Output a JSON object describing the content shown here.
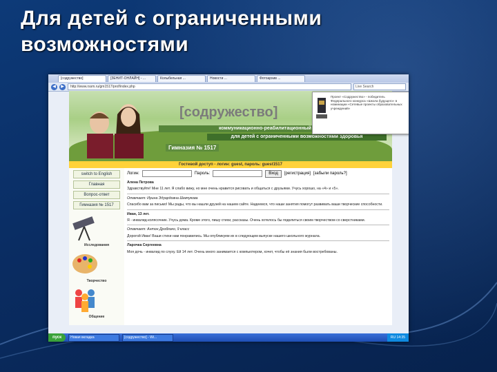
{
  "slide": {
    "title_line1": "Для детей с ограниченными",
    "title_line2": "возможностями"
  },
  "browser": {
    "tabs": [
      {
        "label": "[содружество]",
        "active": true
      },
      {
        "label": "[ЗЕНИТ-ОНЛАЙН] - ...",
        "active": false
      },
      {
        "label": "Колыбельная ...",
        "active": false
      },
      {
        "label": "Новости ...",
        "active": false
      },
      {
        "label": "Фотоархив ...",
        "active": false
      }
    ],
    "address": "http://www.rssm.ru/gm1517/prof/index.php",
    "search_placeholder": "Live Search"
  },
  "site": {
    "brand": "[содружество]",
    "tagline1": "коммуникационно-реабилитационный центр",
    "tagline2": "для детей с ограниченными возможностями здоровья",
    "school": "Гимназия № 1517",
    "guest_notice": "Гостевой доступ - логин: guest, пароль: guest1517",
    "login": {
      "login_label": "Логин:",
      "password_label": "Пароль:",
      "enter_button": "Вход",
      "register_link": "[регистрация]",
      "forgot_link": "[забыли пароль?]"
    },
    "sidebar": {
      "links": [
        "switch to English",
        "Главная",
        "Вопрос-ответ",
        "Гимназия № 1517"
      ],
      "sections": [
        "Исследования",
        "Творчество",
        "Общение"
      ]
    },
    "posts": [
      {
        "author": "Алена Петрова",
        "text": "Здравствуйте! Мне 11 лет. Я слабо вижу, но мне очень нравится рисовать и общаться с друзьями. Учусь хорошо, на «4» и «5»."
      },
      {
        "author": "Отвечает: Ирина Эдуардовна Шевчукова",
        "text": "Спасибо вам за письмо! Мы рады, что вы нашли друзей на нашем сайте. Надеемся, что наши занятия помогут развивать ваши творческие способности."
      },
      {
        "author": "Иван, 13 лет.",
        "text": "Я - инвалид-колясочник. Учусь дома. Кроме этого, пишу стихи, рассказы. Очень хотелось бы поделиться своим творчеством со сверстниками."
      },
      {
        "author": "Отвечает: Антон Дробязко, 9 класс",
        "text": "Дорогой Иван! Ваши стихи нам понравились. Мы опубликуем их в следующем выпуске нашего школьного журнала."
      },
      {
        "author": "Ларочка Сергеевна",
        "text": "Моя дочь - инвалид по слуху. Ей 14 лет. Очень много занимается с компьютером, хочет, чтобы её знания были востребованы."
      }
    ],
    "popup_text": "Проект «Содружество» - победитель Федерального конкурса «Школа будущего» в номинации «Сетевые проекты образовательных учреждений»"
  },
  "taskbar": {
    "start": "пуск",
    "tasks": [
      "Новая вкладка",
      "[содружество] - Wi..."
    ],
    "tray": "RU 14:35"
  }
}
